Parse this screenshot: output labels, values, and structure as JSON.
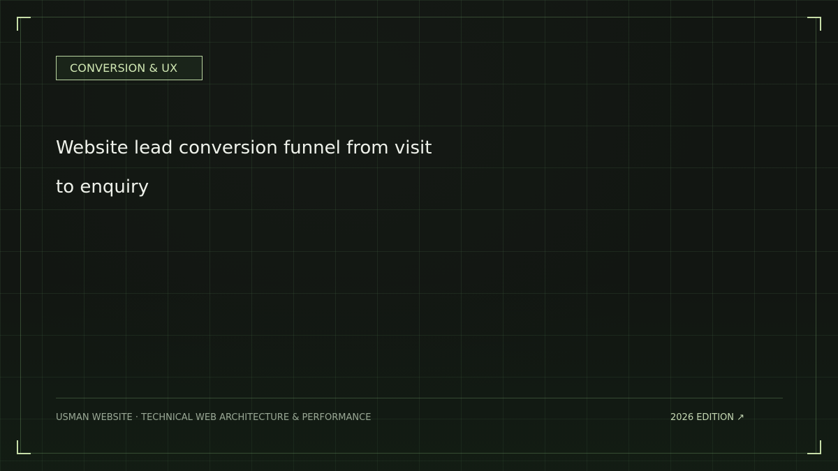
{
  "tag": {
    "label": "CONVERSION & UX"
  },
  "headline": {
    "text": "Website lead conversion funnel from visit to enquiry"
  },
  "footer": {
    "brand": "USMAN WEBSITE · TECHNICAL WEB ARCHITECTURE & PERFORMANCE",
    "edition": "2026 EDITION ↗"
  },
  "colors": {
    "background": "#121612",
    "accent": "#c6dda8",
    "text": "#eef1ea"
  }
}
